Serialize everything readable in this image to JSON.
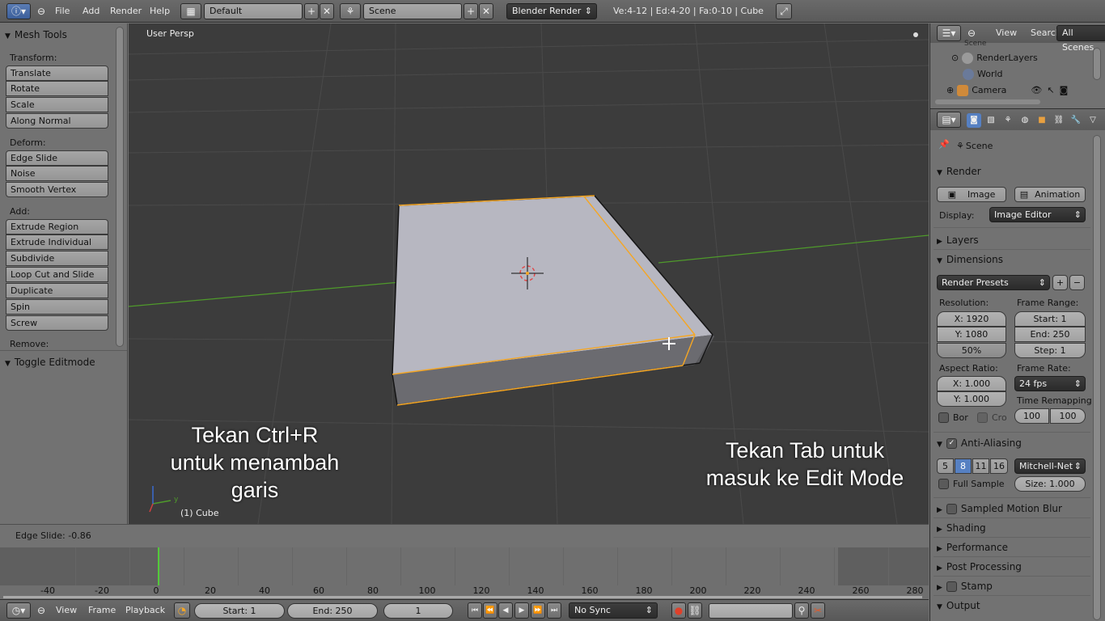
{
  "topbar": {
    "menu": [
      "File",
      "Add",
      "Render",
      "Help"
    ],
    "layout": "Default",
    "scene": "Scene",
    "engine": "Blender Render",
    "stats": "Ve:4-12 | Ed:4-20 | Fa:0-10 | Cube"
  },
  "toolshelf": {
    "title": "Mesh Tools",
    "transform_label": "Transform:",
    "transform": [
      "Translate",
      "Rotate",
      "Scale",
      "Along Normal"
    ],
    "deform_label": "Deform:",
    "deform": [
      "Edge Slide",
      "Noise",
      "Smooth Vertex"
    ],
    "add_label": "Add:",
    "add": [
      "Extrude Region",
      "Extrude Individual",
      "Subdivide",
      "Loop Cut and Slide",
      "Duplicate",
      "Spin",
      "Screw"
    ],
    "remove_label": "Remove:",
    "toggle_editmode": "Toggle Editmode"
  },
  "operator": {
    "last_op": "Edge Slide: -0.86"
  },
  "viewport": {
    "view_label": "User Persp",
    "object_label": "(1) Cube",
    "caption_left": [
      "Tekan Ctrl+R",
      "untuk menambah",
      "garis"
    ],
    "caption_right": [
      "Tekan Tab untuk",
      "masuk ke Edit Mode"
    ],
    "axis_y": "y"
  },
  "timeline": {
    "ticks": [
      "-40",
      "-20",
      "0",
      "20",
      "40",
      "60",
      "80",
      "100",
      "120",
      "140",
      "160",
      "180",
      "200",
      "220",
      "240",
      "260",
      "280"
    ],
    "menu": [
      "View",
      "Frame",
      "Playback"
    ],
    "start": "Start: 1",
    "end": "End: 250",
    "current": "1",
    "sync": "No Sync"
  },
  "outliner": {
    "menu": [
      "View",
      "Search"
    ],
    "filter": "All Scenes",
    "rows": [
      "Scene",
      "RenderLayers",
      "World",
      "Camera"
    ]
  },
  "properties": {
    "context": "Scene",
    "render": {
      "title": "Render",
      "image_btn": "Image",
      "animation_btn": "Animation",
      "display_label": "Display:",
      "display_value": "Image Editor"
    },
    "layers": "Layers",
    "dimensions": {
      "title": "Dimensions",
      "presets": "Render Presets",
      "resolution_label": "Resolution:",
      "res_x": "X: 1920",
      "res_y": "Y: 1080",
      "res_pct": "50%",
      "frame_range_label": "Frame Range:",
      "start": "Start: 1",
      "end": "End: 250",
      "step": "Step: 1",
      "aspect_label": "Aspect Ratio:",
      "aspect_x": "X: 1.000",
      "aspect_y": "Y: 1.000",
      "frame_rate_label": "Frame Rate:",
      "fps": "24 fps",
      "time_remap_label": "Time Remapping",
      "remap_old": "100",
      "remap_new": "100",
      "border": "Bor",
      "crop": "Cro"
    },
    "anti_aliasing": {
      "title": "Anti-Aliasing",
      "samples": [
        "5",
        "8",
        "11",
        "16"
      ],
      "active_sample": "8",
      "filter": "Mitchell-Net",
      "full_sample": "Full Sample",
      "size": "Size: 1.000"
    },
    "collapsed_panels": [
      "Sampled Motion Blur",
      "Shading",
      "Performance",
      "Post Processing",
      "Stamp"
    ],
    "output": "Output"
  },
  "colors": {
    "selection": "#f5a623",
    "x_axis": "#8b2a2a",
    "y_axis": "#4f9a2b",
    "active_tab": "#5680c2",
    "playhead": "#53c83a"
  }
}
